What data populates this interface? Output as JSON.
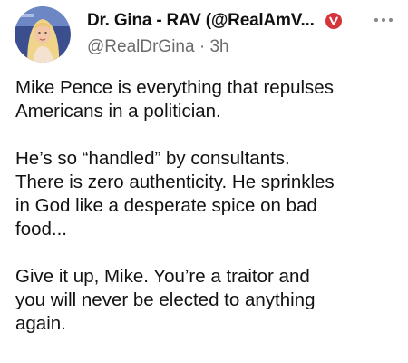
{
  "post": {
    "author": {
      "display_name": "Dr. Gina - RAV (@RealAmV...",
      "handle": "@RealDrGina",
      "separator": "·",
      "time": "3h",
      "verified_badge_color": "#d6343b"
    },
    "more_icon": "more-horizontal-icon",
    "body": {
      "paragraphs": [
        [
          "Mike Pence is everything that repulses",
          "Americans in a politician."
        ],
        [
          "He’s so “handled” by consultants.",
          "There is zero authenticity.  He sprinkles",
          "in God like a desperate spice on bad",
          "food..."
        ],
        [
          "Give it up, Mike.  You’re a traitor and",
          "you will never be elected to anything",
          "again."
        ]
      ]
    }
  }
}
